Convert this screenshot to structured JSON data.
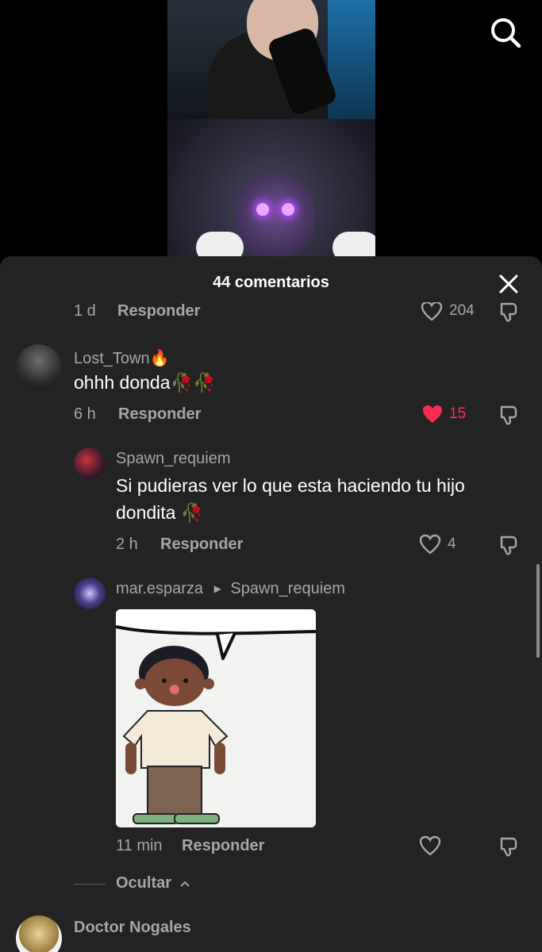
{
  "header": {
    "search_icon": "search-icon"
  },
  "comments_sheet": {
    "title": "44 comentarios",
    "close_icon": "close-icon"
  },
  "previous_comment": {
    "time": "1 d",
    "reply_label": "Responder",
    "likes": "204"
  },
  "comments": [
    {
      "username": "Lost_Town",
      "username_emoji": "🔥",
      "text": "ohhh donda🥀🥀",
      "time": "6 h",
      "reply_label": "Responder",
      "likes": "15",
      "liked": true
    }
  ],
  "replies": [
    {
      "username": "Spawn_requiem",
      "text": "Si pudieras ver lo que esta haciendo tu hijo dondita 🥀",
      "time": "2 h",
      "reply_label": "Responder",
      "likes": "4"
    },
    {
      "username": "mar.esparza",
      "reply_to": "Spawn_requiem",
      "has_image": true,
      "time": "11 min",
      "reply_label": "Responder",
      "likes": ""
    }
  ],
  "hide_replies_label": "Ocultar",
  "next_comment": {
    "username": "Doctor Nogales"
  },
  "colors": {
    "sheet_bg": "#232323",
    "like_active": "#fe2c55",
    "secondary_text": "#a6a6a6"
  }
}
